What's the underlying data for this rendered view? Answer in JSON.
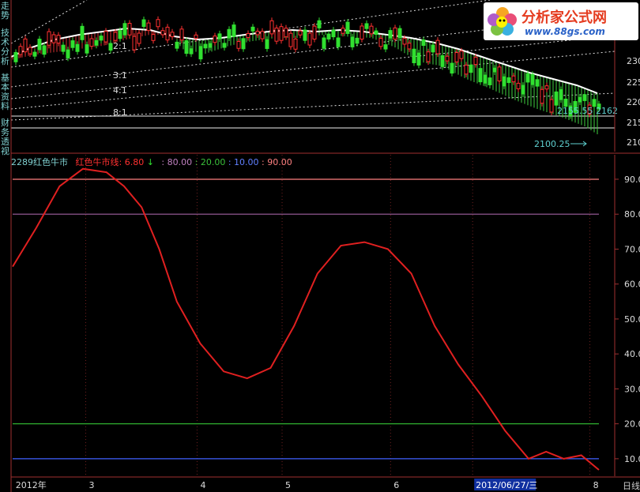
{
  "side_tabs": [
    "走势",
    "技术分析",
    "基本资料",
    "财务透视"
  ],
  "logo": {
    "title": "分析家公式网",
    "url": "www.88gs.com"
  },
  "price_panel": {
    "axis_labels": [
      "230",
      "225",
      "220",
      "215",
      "210"
    ],
    "gann_labels": [
      "2:1",
      "3:1",
      "4:1",
      "8:1"
    ],
    "high_readout": "2155.55 2162",
    "low_readout": "2100.25"
  },
  "indicator": {
    "name": "2289红色牛市",
    "line_label": "红色牛市线: 6.80",
    "arrow": "↓",
    "levels_text": [
      {
        "text": ": 80.00",
        "color": "#c080c0"
      },
      {
        "text": ": 20.00",
        "color": "#3ac03a"
      },
      {
        "text": ": 10.00",
        "color": "#6080ff"
      },
      {
        "text": ": 90.00",
        "color": "#ff8080"
      }
    ]
  },
  "chart_data": {
    "type": "line",
    "ylim": [
      5,
      97
    ],
    "yticks": [
      "90.00",
      "80.00",
      "70.00",
      "60.00",
      "50.00",
      "40.00",
      "30.00",
      "20.00",
      "10.00"
    ],
    "ytick_values": [
      90,
      80,
      70,
      60,
      50,
      40,
      30,
      20,
      10
    ],
    "levels": [
      {
        "value": 90,
        "color": "#ff8080"
      },
      {
        "value": 80,
        "color": "#a060a0"
      },
      {
        "value": 20,
        "color": "#30b030"
      },
      {
        "value": 10,
        "color": "#4060ff"
      }
    ],
    "series": [
      {
        "color": "#e02020",
        "x": [
          0,
          4,
          8,
          12,
          16,
          19,
          22,
          25,
          28,
          32,
          36,
          40,
          44,
          48,
          52,
          56,
          60,
          64,
          68,
          72,
          76,
          80,
          84,
          88,
          91,
          94,
          97,
          100
        ],
        "values": [
          65,
          76,
          88,
          93,
          92,
          88,
          82,
          70,
          55,
          43,
          35,
          33,
          36,
          48,
          63,
          71,
          72,
          70,
          63,
          48,
          37,
          28,
          18,
          10,
          12,
          10,
          11,
          6.8
        ]
      }
    ],
    "x_labels": [
      {
        "text": "2012年",
        "x": 0.5
      },
      {
        "text": "3",
        "x": 13
      },
      {
        "text": "4",
        "x": 32
      },
      {
        "text": "5",
        "x": 46.5
      },
      {
        "text": "6",
        "x": 65
      },
      {
        "text": "2012/06/27/三",
        "x": 79
      },
      {
        "text": "8",
        "x": 99
      }
    ],
    "period_label": "日线"
  }
}
